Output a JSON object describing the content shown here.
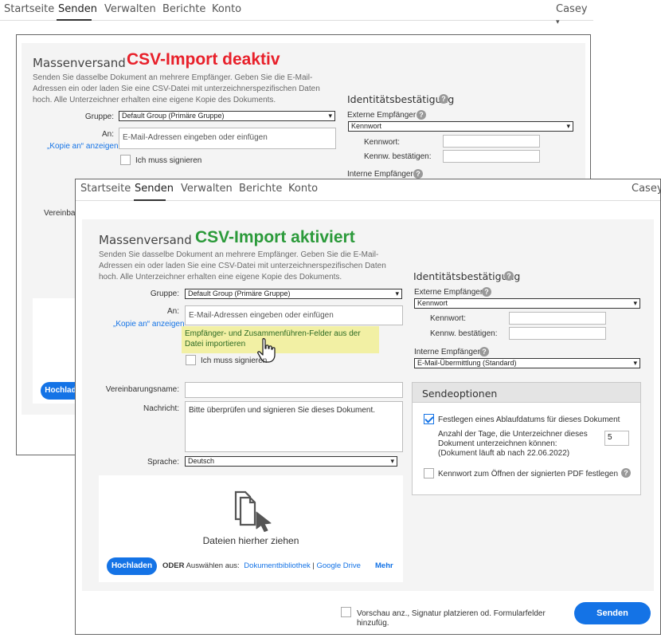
{
  "nav": {
    "items": [
      "Startseite",
      "Senden",
      "Verwalten",
      "Berichte",
      "Konto"
    ],
    "active": "Senden",
    "user": "Casey"
  },
  "annotations": {
    "back": "CSV-Import deaktiv",
    "front": "CSV-Import aktiviert",
    "back_color": "#e8202a",
    "front_color": "#2b9a3a"
  },
  "form": {
    "heading": "Massenversand",
    "description": "Senden Sie dasselbe Dokument an mehrere Empfänger. Geben Sie die E-Mail-Adressen ein oder laden Sie eine CSV-Datei mit unterzeichnerspezifischen Daten hoch. Alle Unterzeichner erhalten eine eigene Kopie des Dokuments.",
    "group_label": "Gruppe:",
    "group_value": "Default Group (Primäre Gruppe)",
    "to_label": "An:",
    "cc_link": "„Kopie an“ anzeigen",
    "email_placeholder": "E-Mail-Adressen eingeben oder einfügen",
    "import_tip": "Empfänger- und Zusammenführen-Felder aus der Datei importieren",
    "i_must_sign": "Ich muss signieren",
    "agreement_label": "Vereinbarungsname:",
    "agreement_label_partial": "Vereinbar",
    "message_label": "Nachricht:",
    "message_value": "Bitte überprüfen und signieren Sie dieses Dokument.",
    "language_label": "Sprache:",
    "language_value": "Deutsch",
    "drop_text": "Dateien hierher ziehen",
    "upload_button": "Hochladen",
    "upload_button_partial": "Hochlad",
    "or_text": "ODER",
    "choose_text": "Auswählen aus:",
    "doc_library": "Dokumentbibliothek",
    "separator": "|",
    "google_drive": "Google Drive",
    "more": "Mehr"
  },
  "identity": {
    "title": "Identitätsbestätigung",
    "external_label": "Externe Empfänger",
    "external_value": "Kennwort",
    "password_label": "Kennwort:",
    "confirm_label": "Kennw. bestätigen:",
    "internal_label": "Interne Empfänger",
    "internal_value": "E-Mail-Übermittlung (Standard)"
  },
  "send_options": {
    "title": "Sendeoptionen",
    "expiry_label": "Festlegen eines Ablaufdatums für dieses Dokument",
    "days_label_1": "Anzahl der Tage, die Unterzeichner dieses",
    "days_label_2": "Dokument unterzeichnen können:",
    "days_label_3": "(Dokument läuft ab nach 22.06.2022)",
    "days_value": "5",
    "pdf_password_label": "Kennwort zum Öffnen der signierten PDF festlegen"
  },
  "footer": {
    "preview_line1": "Vorschau anz., Signatur platzieren od. Formularfelder",
    "preview_line2": "hinzufüg.",
    "send_button": "Senden"
  },
  "icons": {
    "help": "?",
    "caret": "▾"
  }
}
